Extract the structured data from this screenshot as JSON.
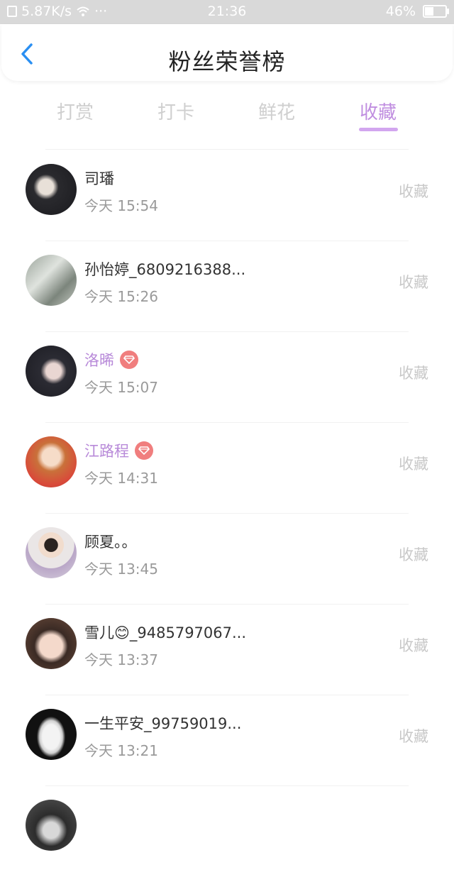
{
  "status_bar": {
    "speed": "5.87K/s",
    "dots": "···",
    "time": "21:36",
    "battery": "46%",
    "battery_level": 0.46
  },
  "header": {
    "title": "粉丝荣誉榜"
  },
  "tabs": [
    {
      "label": "打赏",
      "active": false
    },
    {
      "label": "打卡",
      "active": false
    },
    {
      "label": "鲜花",
      "active": false
    },
    {
      "label": "收藏",
      "active": true
    }
  ],
  "colors": {
    "accent": "#c08ee0",
    "vip_name": "#b88ad9",
    "badge": "#f07e7e",
    "muted": "#c8c8c8"
  },
  "list": [
    {
      "name": "司璠",
      "time": "今天 15:54",
      "action": "收藏",
      "vip": false,
      "avatar_icon": "avatar-dark-portrait"
    },
    {
      "name": "孙怡婷_6809216388...",
      "time": "今天 15:26",
      "action": "收藏",
      "vip": false,
      "avatar_icon": "avatar-room-photo"
    },
    {
      "name": "洛晞",
      "time": "今天 15:07",
      "action": "收藏",
      "vip": true,
      "avatar_icon": "avatar-girl-dark"
    },
    {
      "name": "江路程",
      "time": "今天 14:31",
      "action": "收藏",
      "vip": true,
      "avatar_icon": "avatar-illustrated-girl"
    },
    {
      "name": "顾夏。。",
      "time": "今天 13:45",
      "action": "收藏",
      "vip": false,
      "avatar_icon": "avatar-boy"
    },
    {
      "name": "雪儿😊_9485797067...",
      "time": "今天 13:37",
      "action": "收藏",
      "vip": false,
      "avatar_icon": "avatar-child-glasses"
    },
    {
      "name": "一生平安_99759019...",
      "time": "今天 13:21",
      "action": "收藏",
      "vip": false,
      "avatar_icon": "avatar-jade-pendant"
    }
  ]
}
